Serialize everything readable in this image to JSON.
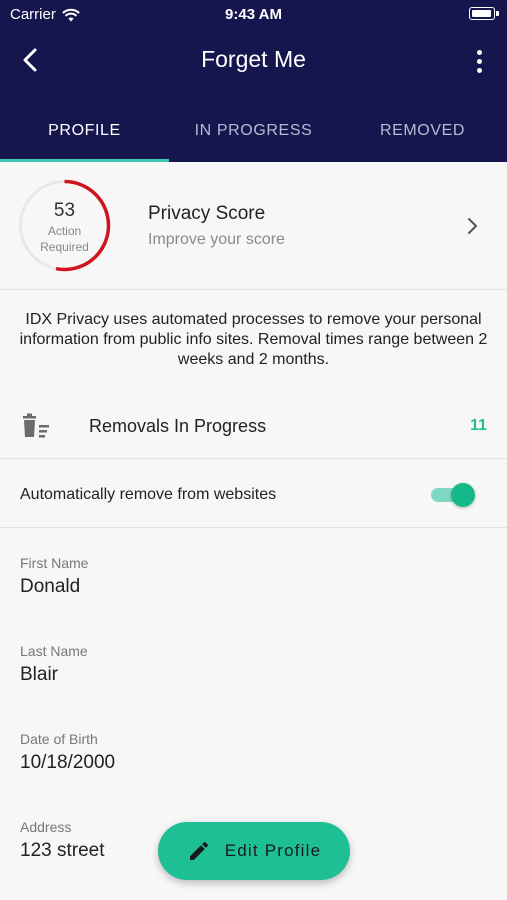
{
  "status": {
    "carrier": "Carrier",
    "time": "9:43 AM"
  },
  "nav": {
    "title": "Forget Me"
  },
  "tabs": [
    {
      "label": "PROFILE",
      "active": true
    },
    {
      "label": "IN PROGRESS",
      "active": false
    },
    {
      "label": "REMOVED",
      "active": false
    }
  ],
  "score": {
    "value": "53",
    "caption_line1": "Action",
    "caption_line2": "Required",
    "title": "Privacy Score",
    "subtitle": "Improve your score",
    "ring_fraction": 0.53,
    "ring_color": "#d0141e"
  },
  "info_text": "IDX Privacy uses automated processes to remove your personal information from public info sites. Removal times range between 2 weeks and 2 months.",
  "removals": {
    "label": "Removals In Progress",
    "count": "11"
  },
  "auto_remove": {
    "label": "Automatically remove from websites",
    "enabled": true
  },
  "profile": {
    "first_name": {
      "label": "First Name",
      "value": "Donald"
    },
    "last_name": {
      "label": "Last Name",
      "value": "Blair"
    },
    "dob": {
      "label": "Date of Birth",
      "value": "10/18/2000"
    },
    "address": {
      "label": "Address",
      "value": "123 street"
    }
  },
  "fab": {
    "label": "Edit Profile",
    "icon": "pencil-icon"
  },
  "colors": {
    "header": "#16164f",
    "accent": "#1fbf96",
    "tab_indicator": "#3cc7b3"
  }
}
